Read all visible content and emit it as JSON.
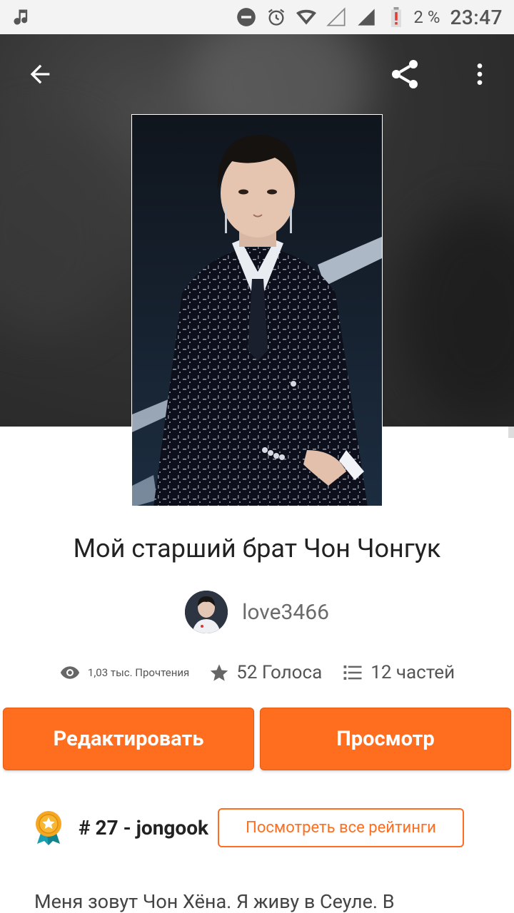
{
  "status_bar": {
    "icons": [
      "music-note-icon",
      "do-not-disturb-icon",
      "alarm-icon",
      "wifi-icon",
      "signal-icon",
      "signal-icon",
      "battery-low-icon"
    ],
    "battery_percent": "2 %",
    "time": "23:47"
  },
  "toolbar": {
    "back_icon": "arrow-left-icon",
    "share_icon": "share-icon",
    "more_icon": "more-vertical-icon"
  },
  "story": {
    "title": "Мой старший брат Чон Чонгук",
    "author": "love3466",
    "reads": "1,03 тыс. Прочтения",
    "votes": "52 Голоса",
    "parts": "12 частей"
  },
  "actions": {
    "edit_label": "Редактировать",
    "view_label": "Просмотр"
  },
  "ranking": {
    "text": "# 27 - jongook",
    "button_label": "Посмотреть все рейтинги"
  },
  "description": "Меня зовут Чон Хёна. Я живу в Сеуле. В",
  "colors": {
    "accent": "#ff6d1f",
    "hero_bg": "#2e2e2e"
  }
}
